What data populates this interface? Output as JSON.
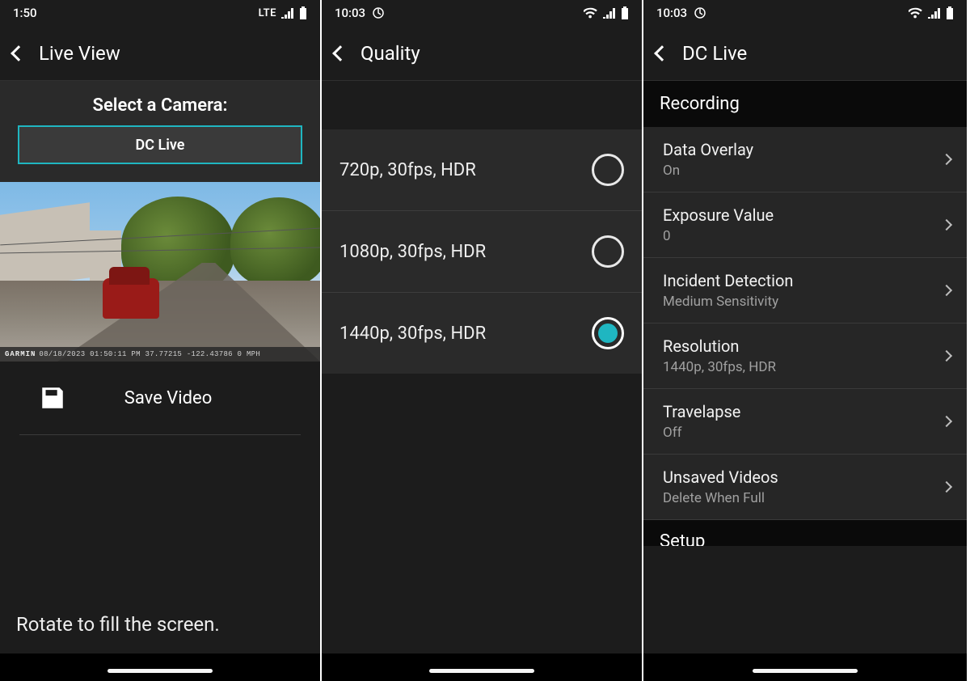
{
  "screen1": {
    "status": {
      "time": "1:50",
      "network": "LTE"
    },
    "header": {
      "title": "Live View"
    },
    "selector": {
      "heading": "Select a Camera:",
      "camera_name": "DC Live"
    },
    "osd": {
      "brand": "GARMIN",
      "text": "08/18/2023 01:50:11 PM  37.77215 -122.43786  0 MPH"
    },
    "save_label": "Save Video",
    "rotate_hint": "Rotate to fill the screen."
  },
  "screen2": {
    "status": {
      "time": "10:03"
    },
    "header": {
      "title": "Quality"
    },
    "options": [
      {
        "label": "720p, 30fps, HDR",
        "selected": false
      },
      {
        "label": "1080p, 30fps, HDR",
        "selected": false
      },
      {
        "label": "1440p, 30fps, HDR",
        "selected": true
      }
    ]
  },
  "screen3": {
    "status": {
      "time": "10:03"
    },
    "header": {
      "title": "DC Live"
    },
    "section_title": "Recording",
    "items": [
      {
        "title": "Data Overlay",
        "value": "On"
      },
      {
        "title": "Exposure Value",
        "value": "0"
      },
      {
        "title": "Incident Detection",
        "value": "Medium Sensitivity"
      },
      {
        "title": "Resolution",
        "value": "1440p, 30fps, HDR"
      },
      {
        "title": "Travelapse",
        "value": "Off"
      },
      {
        "title": "Unsaved Videos",
        "value": "Delete When Full"
      }
    ],
    "next_section": "Setup"
  }
}
